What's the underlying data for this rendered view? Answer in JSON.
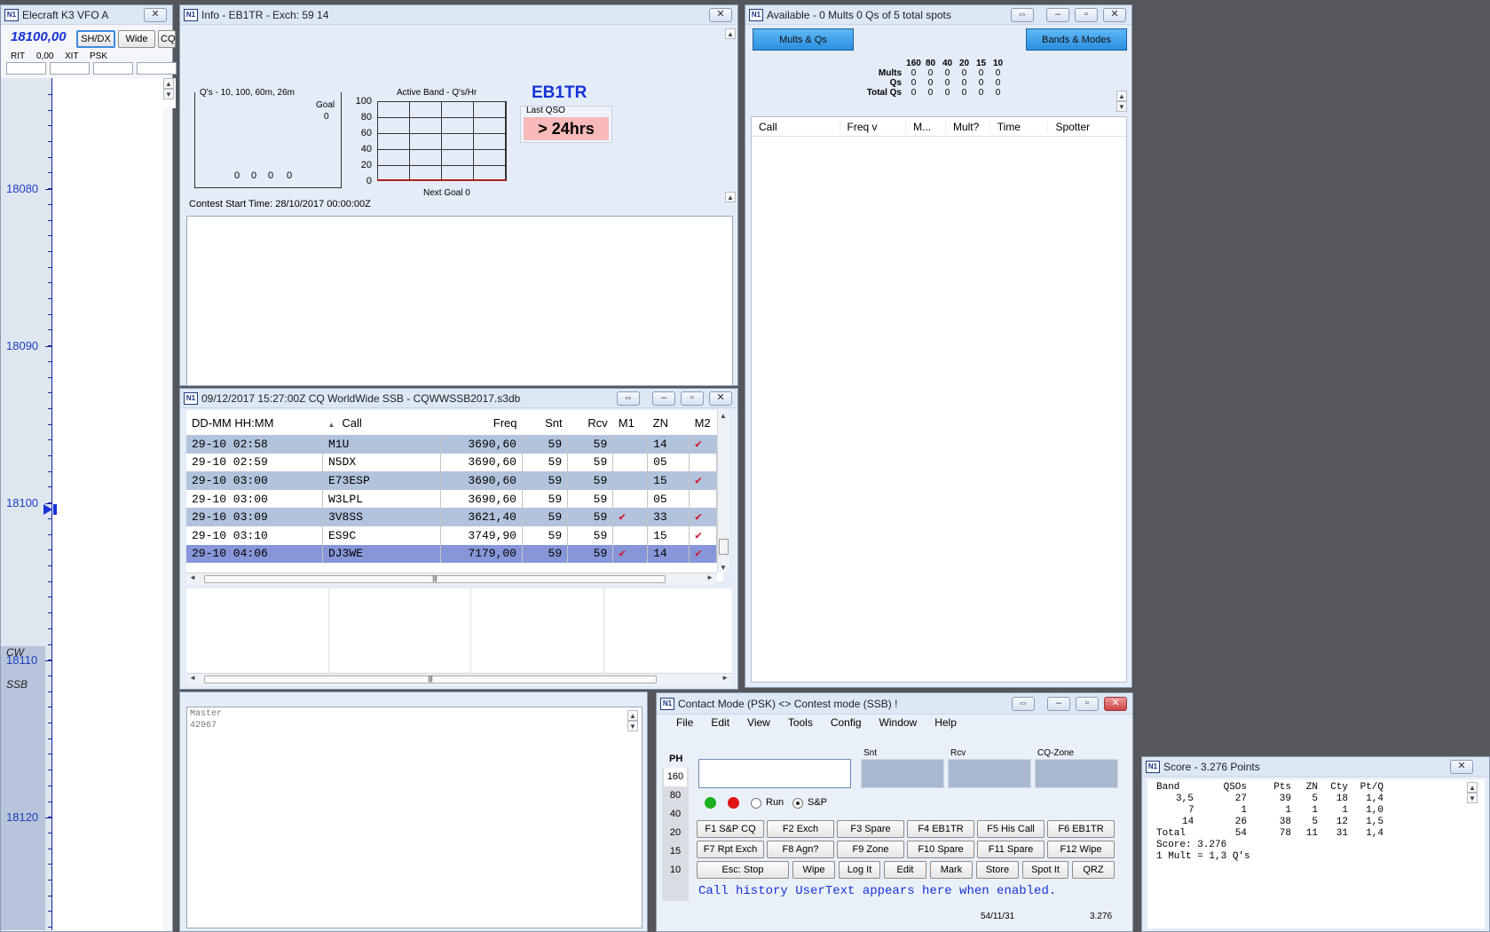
{
  "vfo": {
    "title": "Elecraft K3 VFO A",
    "freq": "18100,00",
    "btn_shdx": "SH/DX",
    "btn_wide": "Wide",
    "btn_cq": "CQ",
    "rit": "RIT",
    "rit_val": "0,00",
    "xit": "XIT",
    "psk": "PSK",
    "ticks": [
      "18080",
      "18090",
      "18100",
      "18110",
      "18120"
    ],
    "cw": "CW",
    "ssb": "SSB"
  },
  "info": {
    "title": "Info - EB1TR - Exch: 59 14",
    "qs_title": "Q's - 10, 100, 60m, 26m",
    "goal": "Goal",
    "goal_val": "0",
    "qs_vals": [
      "0",
      "0",
      "0",
      "0"
    ],
    "band_title": "Active Band - Q's/Hr",
    "y_ticks": [
      "100",
      "80",
      "60",
      "40",
      "20",
      "0"
    ],
    "next_goal": "Next Goal 0",
    "call": "EB1TR",
    "last_qso": "Last QSO",
    "last_qso_val": "> 24hrs",
    "start_time": "Contest Start Time:  28/10/2017 00:00:00Z"
  },
  "available": {
    "title": "Available - 0 Mults 0 Qs of 5 total spots",
    "btn_mults": "Mults & Qs",
    "btn_bands": "Bands & Modes",
    "bands": [
      "160",
      "80",
      "40",
      "20",
      "15",
      "10"
    ],
    "rows": [
      {
        "label": "Mults",
        "vals": [
          "0",
          "0",
          "0",
          "0",
          "0",
          "0"
        ]
      },
      {
        "label": "Qs",
        "vals": [
          "0",
          "0",
          "0",
          "0",
          "0",
          "0"
        ]
      },
      {
        "label": "Total Qs",
        "vals": [
          "0",
          "0",
          "0",
          "0",
          "0",
          "0"
        ]
      }
    ],
    "cols": [
      "Call",
      "Freq v",
      "M...",
      "Mult?",
      "Time",
      "Spotter"
    ]
  },
  "log": {
    "title": "09/12/2017 15:27:00Z  CQ WorldWide SSB - CQWWSSB2017.s3db",
    "headers": [
      "DD-MM HH:MM",
      "Call",
      "Freq",
      "Snt",
      "Rcv",
      "M1",
      "ZN",
      "M2"
    ],
    "rows": [
      {
        "date": "29-10 02:58",
        "call": "M1U",
        "freq": "3690,60",
        "snt": "59",
        "rcv": "59",
        "m1": "",
        "zn": "14",
        "m2": "✔"
      },
      {
        "date": "29-10 02:59",
        "call": "N5DX",
        "freq": "3690,60",
        "snt": "59",
        "rcv": "59",
        "m1": "",
        "zn": "05",
        "m2": ""
      },
      {
        "date": "29-10 03:00",
        "call": "E73ESP",
        "freq": "3690,60",
        "snt": "59",
        "rcv": "59",
        "m1": "",
        "zn": "15",
        "m2": "✔"
      },
      {
        "date": "29-10 03:00",
        "call": "W3LPL",
        "freq": "3690,60",
        "snt": "59",
        "rcv": "59",
        "m1": "",
        "zn": "05",
        "m2": ""
      },
      {
        "date": "29-10 03:09",
        "call": "3V8SS",
        "freq": "3621,40",
        "snt": "59",
        "rcv": "59",
        "m1": "✔",
        "zn": "33",
        "m2": "✔"
      },
      {
        "date": "29-10 03:10",
        "call": "ES9C",
        "freq": "3749,90",
        "snt": "59",
        "rcv": "59",
        "m1": "",
        "zn": "15",
        "m2": "✔"
      },
      {
        "date": "29-10 04:06",
        "call": "DJ3WE",
        "freq": "7179,00",
        "snt": "59",
        "rcv": "59",
        "m1": "✔",
        "zn": "14",
        "m2": "✔"
      }
    ]
  },
  "master": {
    "label": "Master",
    "value": "42967"
  },
  "entry": {
    "title": "Contact Mode (PSK) <> Contest mode (SSB) !",
    "menu": [
      "File",
      "Edit",
      "View",
      "Tools",
      "Config",
      "Window",
      "Help"
    ],
    "mode": "PH",
    "bands": [
      "160",
      "80",
      "40",
      "20",
      "15",
      "10"
    ],
    "lbl_snt": "Snt",
    "lbl_rcv": "Rcv",
    "lbl_cqzone": "CQ-Zone",
    "run": "Run",
    "sp": "S&P",
    "fkeys_row1": [
      "F1 S&P CQ",
      "F2 Exch",
      "F3 Spare",
      "F4 EB1TR",
      "F5 His Call",
      "F6 EB1TR"
    ],
    "fkeys_row2": [
      "F7 Rpt Exch",
      "F8 Agn?",
      "F9 Zone",
      "F10 Spare",
      "F11 Spare",
      "F12 Wipe"
    ],
    "fkeys_row3": [
      "Esc: Stop",
      "Wipe",
      "Log It",
      "Edit",
      "Mark",
      "Store",
      "Spot It",
      "QRZ"
    ],
    "history": "Call history UserText appears here when enabled.",
    "status_left": "54/11/31",
    "status_right": "3.276"
  },
  "score": {
    "title": "Score - 3.276 Points",
    "headers": [
      "Band",
      "QSOs",
      "Pts",
      "ZN",
      "Cty",
      "Pt/Q"
    ],
    "rows": [
      [
        "3,5",
        "27",
        "39",
        "5",
        "18",
        "1,4"
      ],
      [
        "7",
        "1",
        "1",
        "1",
        "1",
        "1,0"
      ],
      [
        "14",
        "26",
        "38",
        "5",
        "12",
        "1,5"
      ],
      [
        "Total",
        "54",
        "78",
        "11",
        "31",
        "1,4"
      ]
    ],
    "score_line": "Score: 3.276",
    "mult_line": "1 Mult = 1,3 Q's"
  }
}
